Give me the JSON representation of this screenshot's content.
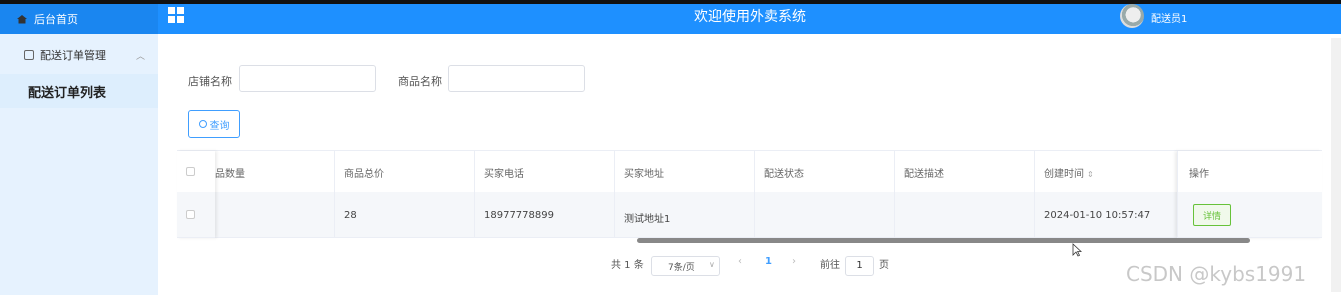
{
  "header": {
    "home_label": "后台首页",
    "title": "欢迎使用外卖系统",
    "user_name": "配送员1"
  },
  "sidebar": {
    "group_label": "配送订单管理",
    "items": [
      {
        "label": "配送订单列表"
      }
    ]
  },
  "filters": {
    "shop_name_label": "店铺名称",
    "shop_name_value": "",
    "product_name_label": "商品名称",
    "product_name_value": "",
    "search_button": "查询"
  },
  "table": {
    "columns": [
      "品数量",
      "商品总价",
      "买家电话",
      "买家地址",
      "配送状态",
      "配送描述",
      "创建时间",
      "操作"
    ],
    "rows": [
      {
        "quantity": "",
        "total_price": "28",
        "phone": "18977778899",
        "address": "测试地址1",
        "status": "",
        "description": "",
        "created_at": "2024-01-10 10:57:47",
        "action": "详情"
      }
    ]
  },
  "pagination": {
    "total": "共 1 条",
    "page_size": "7条/页",
    "current_page": "1",
    "goto_label": "前往",
    "goto_value": "1",
    "page_unit": "页"
  },
  "watermark": "CSDN @kybs1991",
  "colors": {
    "header_blue": "#1e90ff",
    "sidebar_bg": "#e6f2fe",
    "primary": "#409eff",
    "success": "#67c23a"
  }
}
